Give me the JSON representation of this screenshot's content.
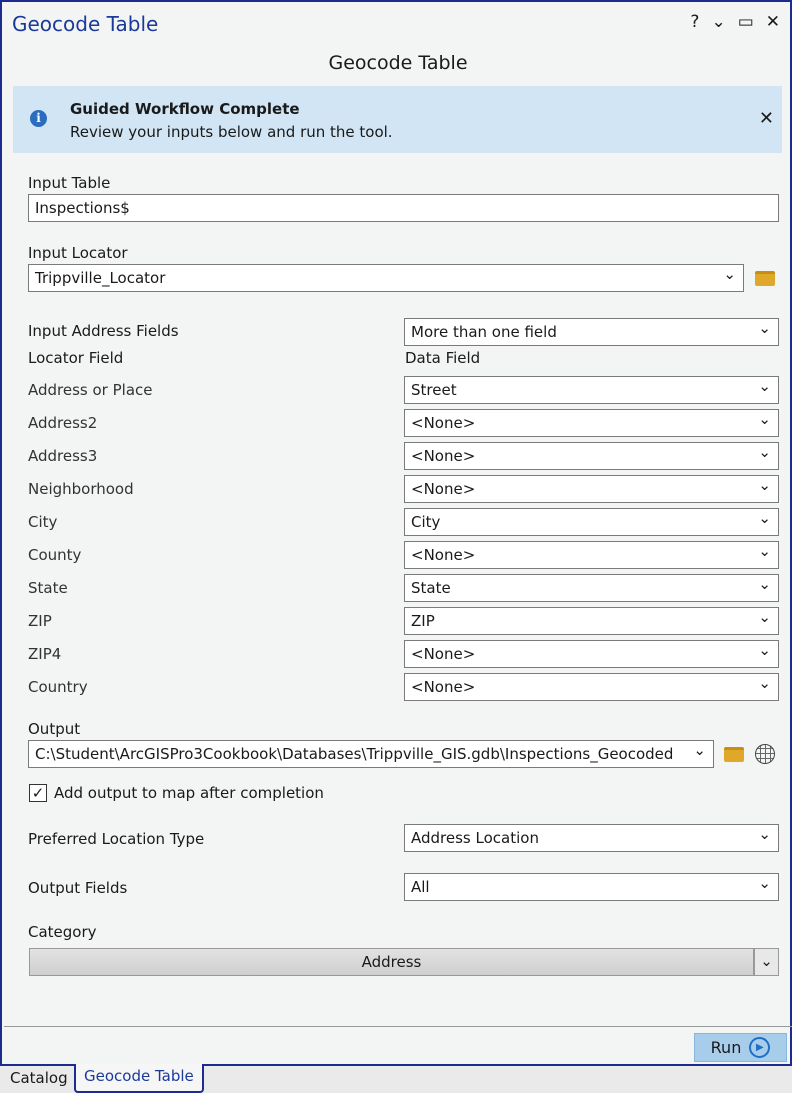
{
  "window": {
    "title": "Geocode Table",
    "controls": [
      "?",
      "⌄",
      "▭",
      "✕"
    ]
  },
  "heading": "Geocode Table",
  "banner": {
    "title": "Guided Workflow Complete",
    "message": "Review your inputs below and run the tool.",
    "close": "✕"
  },
  "input_table": {
    "label": "Input Table",
    "value": "Inspections$"
  },
  "input_locator": {
    "label": "Input Locator",
    "value": "Trippville_Locator"
  },
  "address_fields": {
    "label": "Input Address Fields",
    "value": "More than one field"
  },
  "mapping": {
    "locator_header": "Locator Field",
    "data_header": "Data Field",
    "rows": [
      {
        "field": "Address or Place",
        "value": "Street"
      },
      {
        "field": "Address2",
        "value": "<None>"
      },
      {
        "field": "Address3",
        "value": "<None>"
      },
      {
        "field": "Neighborhood",
        "value": "<None>"
      },
      {
        "field": "City",
        "value": "City"
      },
      {
        "field": "County",
        "value": "<None>"
      },
      {
        "field": "State",
        "value": "State"
      },
      {
        "field": "ZIP",
        "value": "ZIP"
      },
      {
        "field": "ZIP4",
        "value": "<None>"
      },
      {
        "field": "Country",
        "value": "<None>"
      }
    ]
  },
  "output": {
    "label": "Output",
    "value": "C:\\Student\\ArcGISPro3Cookbook\\Databases\\Trippville_GIS.gdb\\Inspections_Geocoded"
  },
  "add_to_map": {
    "label": "Add output to map after completion",
    "checked": true
  },
  "location_type": {
    "label": "Preferred Location Type",
    "value": "Address Location"
  },
  "output_fields": {
    "label": "Output Fields",
    "value": "All"
  },
  "category": {
    "label": "Category",
    "value": "Address"
  },
  "run": "Run",
  "tabs": [
    {
      "label": "Catalog",
      "active": false
    },
    {
      "label": "Geocode Table",
      "active": true
    }
  ]
}
